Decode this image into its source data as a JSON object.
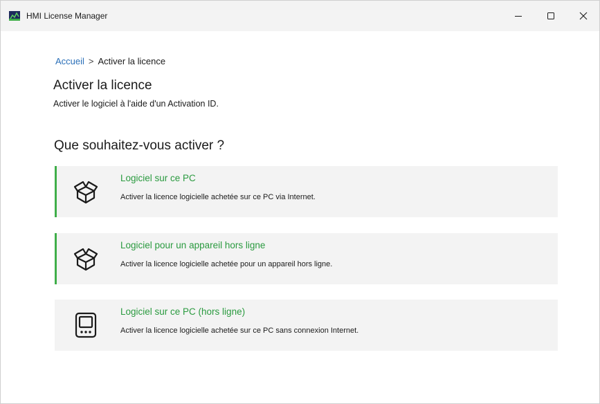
{
  "window": {
    "title": "HMI License Manager",
    "controls": {
      "minimize": "–",
      "maximize": "☐",
      "close": "✕"
    }
  },
  "breadcrumb": {
    "home": "Accueil",
    "separator": ">",
    "current": "Activer la licence"
  },
  "page": {
    "title": "Activer la licence",
    "subtitle": "Activer le logiciel à l'aide d'un Activation ID."
  },
  "section": {
    "title": "Que souhaitez-vous activer ?"
  },
  "options": [
    {
      "title": "Logiciel sur ce PC",
      "description": "Activer la licence logicielle achetée sur ce PC via Internet.",
      "icon": "box-icon",
      "accent": true
    },
    {
      "title": "Logiciel pour un appareil hors ligne",
      "description": "Activer la licence logicielle achetée pour un appareil hors ligne.",
      "icon": "box-icon",
      "accent": true
    },
    {
      "title": "Logiciel sur ce PC (hors ligne)",
      "description": "Activer la licence logicielle achetée sur ce PC sans connexion Internet.",
      "icon": "device-icon",
      "accent": false
    }
  ],
  "colors": {
    "accent_green": "#3fae49",
    "link_blue": "#2a6fb8",
    "option_title_green": "#2a9a3f",
    "card_background": "#f3f3f3"
  }
}
